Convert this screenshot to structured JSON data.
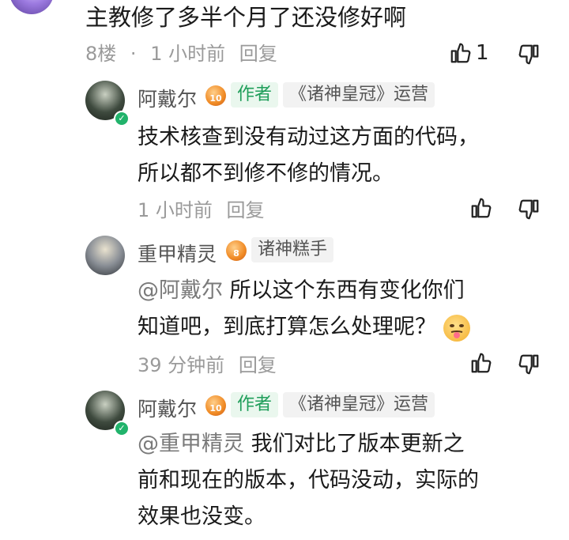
{
  "main_comment": {
    "text": "主教修了多半个月了还没修好啊",
    "floor": "8楼",
    "separator": "·",
    "time": "1 小时前",
    "reply_label": "回复",
    "like_count": "1"
  },
  "replies": [
    {
      "user": "阿戴尔",
      "level": "10",
      "author_tag": "作者",
      "role_tag": "《诸神皇冠》运营",
      "lines": [
        "技术核查到没有动过这方面的代码，",
        "所以都不到修不修的情况。"
      ],
      "time": "1 小时前",
      "reply_label": "回复"
    },
    {
      "user": "重甲精灵",
      "level": "8",
      "role_tag": "诸神糕手",
      "mention": "@阿戴尔",
      "line1_rest": "所以这个东西有变化你们",
      "line2": "知道吧，到底打算怎么处理呢？",
      "time": "39 分钟前",
      "reply_label": "回复"
    },
    {
      "user": "阿戴尔",
      "level": "10",
      "author_tag": "作者",
      "role_tag": "《诸神皇冠》运营",
      "mention": "@重甲精灵",
      "line1_rest": "我们对比了版本更新之",
      "line2": "前和现在的版本，代码没动，实际的",
      "line3": "效果也没变。"
    }
  ],
  "colors": {
    "author_green": "#1f9e5a",
    "meta_gray": "#9a9a9a",
    "level_orange": "#f08a24"
  },
  "icons": [
    "thumb-up-icon",
    "thumb-down-icon",
    "verified-badge-icon",
    "level-badge-icon",
    "emoji-face-icon"
  ]
}
